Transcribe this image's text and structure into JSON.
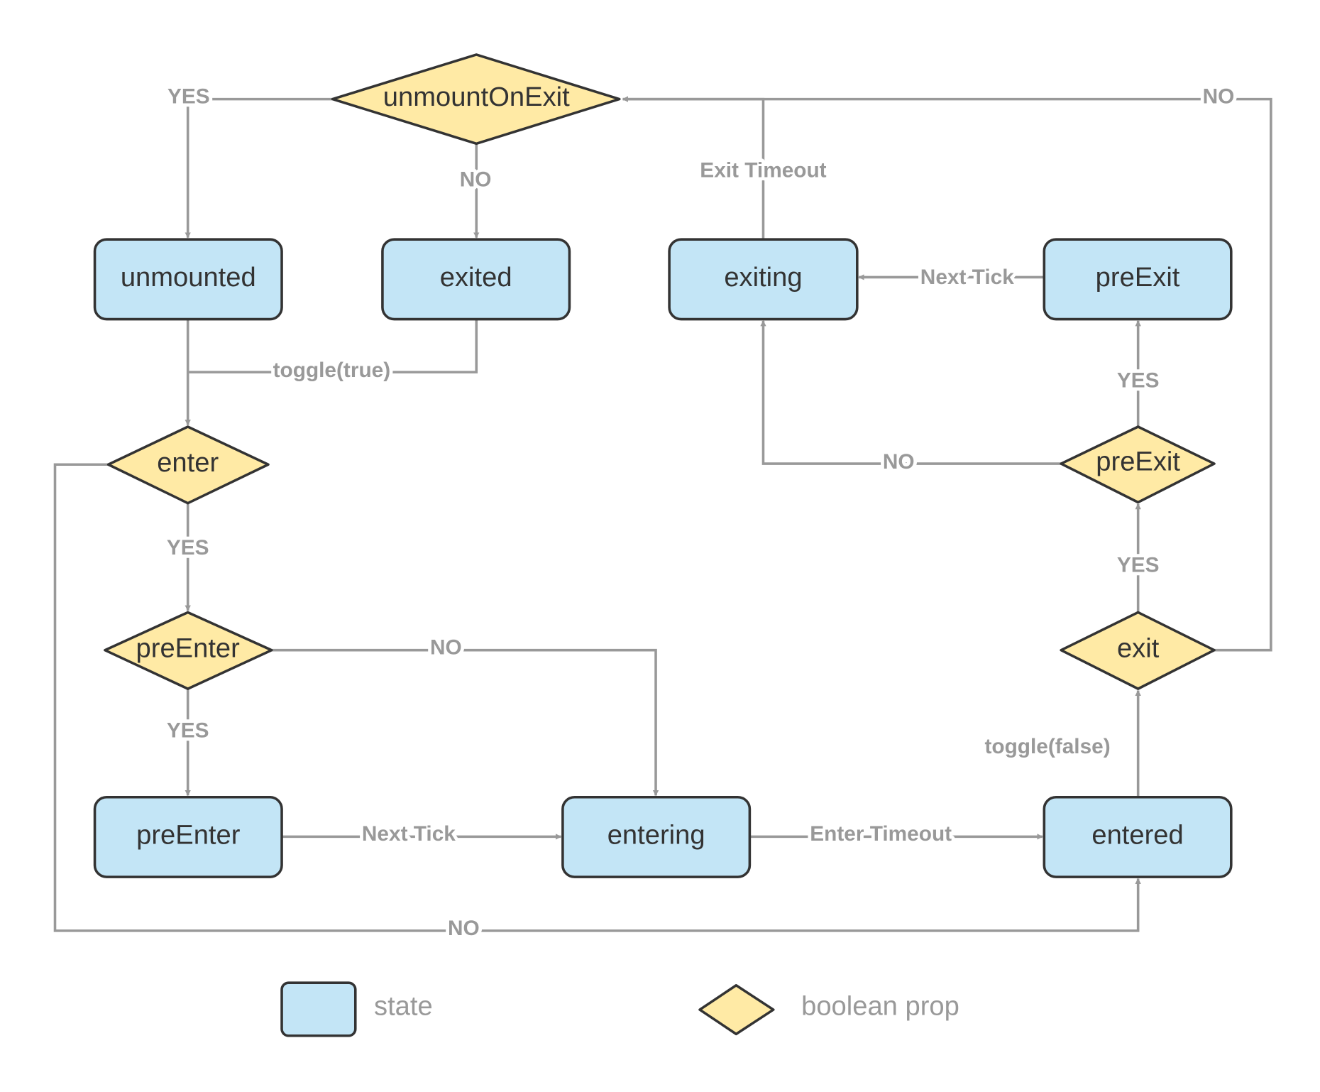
{
  "colors": {
    "state_fill": "#c3e5f6",
    "boolean_fill": "#ffeaa5",
    "outline": "#333333",
    "edge": "#999999"
  },
  "nodes": [
    {
      "id": "d-unmountOnExit",
      "label": "unmountOnExit",
      "kind": "boolean prop"
    },
    {
      "id": "s-unmounted",
      "label": "unmounted",
      "kind": "state"
    },
    {
      "id": "s-exited",
      "label": "exited",
      "kind": "state"
    },
    {
      "id": "s-exiting",
      "label": "exiting",
      "kind": "state"
    },
    {
      "id": "s-preExit",
      "label": "preExit",
      "kind": "state"
    },
    {
      "id": "d-enter",
      "label": "enter",
      "kind": "boolean prop"
    },
    {
      "id": "d-preEnter",
      "label": "preEnter",
      "kind": "boolean prop"
    },
    {
      "id": "d-preExit",
      "label": "preExit",
      "kind": "boolean prop"
    },
    {
      "id": "d-exit",
      "label": "exit",
      "kind": "boolean prop"
    },
    {
      "id": "s-preEnter",
      "label": "preEnter",
      "kind": "state"
    },
    {
      "id": "s-entering",
      "label": "entering",
      "kind": "state"
    },
    {
      "id": "s-entered",
      "label": "entered",
      "kind": "state"
    }
  ],
  "edges": [
    {
      "from": "d-unmountOnExit",
      "to": "s-unmounted",
      "label": "YES"
    },
    {
      "from": "d-unmountOnExit",
      "to": "s-exited",
      "label": "NO"
    },
    {
      "from": "s-exiting",
      "to": "d-unmountOnExit",
      "label": "Exit Timeout"
    },
    {
      "from": "d-exit",
      "to": "d-unmountOnExit",
      "label": "NO"
    },
    {
      "from": "s-preExit",
      "to": "s-exiting",
      "label": "Next Tick"
    },
    {
      "from": "s-unmounted",
      "to": "d-enter",
      "label": ""
    },
    {
      "from": "s-exited",
      "to": "d-enter",
      "label": "toggle(true)"
    },
    {
      "from": "d-enter",
      "to": "d-preEnter",
      "label": "YES"
    },
    {
      "from": "d-preEnter",
      "to": "s-entering",
      "label": "NO"
    },
    {
      "from": "d-preEnter",
      "to": "s-preEnter",
      "label": "YES"
    },
    {
      "from": "s-preEnter",
      "to": "s-entering",
      "label": "Next Tick"
    },
    {
      "from": "s-entering",
      "to": "s-entered",
      "label": "Enter Timeout"
    },
    {
      "from": "d-enter",
      "to": "s-entered",
      "label": "NO"
    },
    {
      "from": "s-entered",
      "to": "d-exit",
      "label": "toggle(false)"
    },
    {
      "from": "d-exit",
      "to": "d-preExit",
      "label": "YES"
    },
    {
      "from": "d-preExit",
      "to": "s-preExit",
      "label": "YES"
    },
    {
      "from": "d-preExit",
      "to": "s-exiting",
      "label": "NO"
    }
  ],
  "legend": {
    "state_label": "state",
    "boolean_label": "boolean prop"
  }
}
